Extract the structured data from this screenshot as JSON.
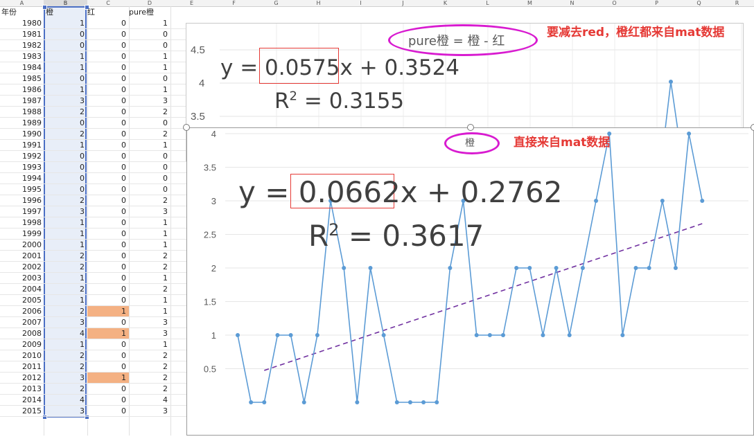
{
  "spreadsheet": {
    "column_headers": [
      "A",
      "B",
      "C",
      "D",
      "E",
      "F",
      "G",
      "H",
      "I",
      "J",
      "K",
      "L",
      "M",
      "N",
      "O",
      "P",
      "Q",
      "R"
    ],
    "table_headers": [
      "年份",
      "橙",
      "红",
      "pure橙"
    ],
    "rows": [
      {
        "year": "1980",
        "orange": "1",
        "red": "0",
        "pure": "1"
      },
      {
        "year": "1981",
        "orange": "0",
        "red": "0",
        "pure": "0"
      },
      {
        "year": "1982",
        "orange": "0",
        "red": "0",
        "pure": "0"
      },
      {
        "year": "1983",
        "orange": "1",
        "red": "0",
        "pure": "1"
      },
      {
        "year": "1984",
        "orange": "1",
        "red": "0",
        "pure": "1"
      },
      {
        "year": "1985",
        "orange": "0",
        "red": "0",
        "pure": "0"
      },
      {
        "year": "1986",
        "orange": "1",
        "red": "0",
        "pure": "1"
      },
      {
        "year": "1987",
        "orange": "3",
        "red": "0",
        "pure": "3"
      },
      {
        "year": "1988",
        "orange": "2",
        "red": "0",
        "pure": "2"
      },
      {
        "year": "1989",
        "orange": "0",
        "red": "0",
        "pure": "0"
      },
      {
        "year": "1990",
        "orange": "2",
        "red": "0",
        "pure": "2"
      },
      {
        "year": "1991",
        "orange": "1",
        "red": "0",
        "pure": "1"
      },
      {
        "year": "1992",
        "orange": "0",
        "red": "0",
        "pure": "0"
      },
      {
        "year": "1993",
        "orange": "0",
        "red": "0",
        "pure": "0"
      },
      {
        "year": "1994",
        "orange": "0",
        "red": "0",
        "pure": "0"
      },
      {
        "year": "1995",
        "orange": "0",
        "red": "0",
        "pure": "0"
      },
      {
        "year": "1996",
        "orange": "2",
        "red": "0",
        "pure": "2"
      },
      {
        "year": "1997",
        "orange": "3",
        "red": "0",
        "pure": "3"
      },
      {
        "year": "1998",
        "orange": "1",
        "red": "0",
        "pure": "1"
      },
      {
        "year": "1999",
        "orange": "1",
        "red": "0",
        "pure": "1"
      },
      {
        "year": "2000",
        "orange": "1",
        "red": "0",
        "pure": "1"
      },
      {
        "year": "2001",
        "orange": "2",
        "red": "0",
        "pure": "2"
      },
      {
        "year": "2002",
        "orange": "2",
        "red": "0",
        "pure": "2"
      },
      {
        "year": "2003",
        "orange": "1",
        "red": "0",
        "pure": "1"
      },
      {
        "year": "2004",
        "orange": "2",
        "red": "0",
        "pure": "2"
      },
      {
        "year": "2005",
        "orange": "1",
        "red": "0",
        "pure": "1"
      },
      {
        "year": "2006",
        "orange": "2",
        "red": "1",
        "pure": "1"
      },
      {
        "year": "2007",
        "orange": "3",
        "red": "0",
        "pure": "3"
      },
      {
        "year": "2008",
        "orange": "4",
        "red": "1",
        "pure": "3"
      },
      {
        "year": "2009",
        "orange": "1",
        "red": "0",
        "pure": "1"
      },
      {
        "year": "2010",
        "orange": "2",
        "red": "0",
        "pure": "2"
      },
      {
        "year": "2011",
        "orange": "2",
        "red": "0",
        "pure": "2"
      },
      {
        "year": "2012",
        "orange": "3",
        "red": "1",
        "pure": "2"
      },
      {
        "year": "2013",
        "orange": "2",
        "red": "0",
        "pure": "2"
      },
      {
        "year": "2014",
        "orange": "4",
        "red": "0",
        "pure": "4"
      },
      {
        "year": "2015",
        "orange": "3",
        "red": "0",
        "pure": "3"
      }
    ],
    "highlight_color": "#f4b183",
    "selection_color": "#4b6fc4"
  },
  "annotations": {
    "top_formula": "pure橙 = 橙 - 红",
    "top_note": "要减去red，橙红都来自mat数据",
    "bottom_title": "橙",
    "bottom_note": "直接来自mat数据",
    "accent_color": "#d81bd0",
    "note_color": "#e53935"
  },
  "chart_data": [
    {
      "type": "line",
      "series_name": "pure橙",
      "trendline": {
        "equation_prefix": "y = ",
        "slope": "0.0575",
        "equation_suffix": "x + 0.3524",
        "r2_label": "R",
        "r2_value": "= 0.3155"
      },
      "visible_yticks": [
        "4.5",
        "4",
        "3.5"
      ],
      "visible_peak": {
        "x_index": 35,
        "y": 4
      }
    },
    {
      "type": "line",
      "series_name": "橙",
      "x": [
        1980,
        1981,
        1982,
        1983,
        1984,
        1985,
        1986,
        1987,
        1988,
        1989,
        1990,
        1991,
        1992,
        1993,
        1994,
        1995,
        1996,
        1997,
        1998,
        1999,
        2000,
        2001,
        2002,
        2003,
        2004,
        2005,
        2006,
        2007,
        2008,
        2009,
        2010,
        2011,
        2012,
        2013,
        2014,
        2015
      ],
      "y": [
        1,
        0,
        0,
        1,
        1,
        0,
        1,
        3,
        2,
        0,
        2,
        1,
        0,
        0,
        0,
        0,
        2,
        3,
        1,
        1,
        1,
        2,
        2,
        1,
        2,
        1,
        2,
        3,
        4,
        1,
        2,
        2,
        3,
        2,
        4,
        3
      ],
      "yticks": [
        "4.5",
        "4",
        "3.5",
        "3",
        "2.5",
        "2",
        "1.5",
        "1",
        "0.5"
      ],
      "ylim": [
        0,
        4.5
      ],
      "trendline": {
        "style": "dashed linear",
        "slope_numeric": 0.0662,
        "intercept_numeric": 0.2762,
        "equation_prefix": "y = ",
        "slope": "0.0662",
        "equation_suffix": "x + 0.2762",
        "r2_label": "R",
        "r2_value": "= 0.3617"
      },
      "line_color": "#5b9bd5",
      "trend_color": "#7030a0"
    }
  ]
}
